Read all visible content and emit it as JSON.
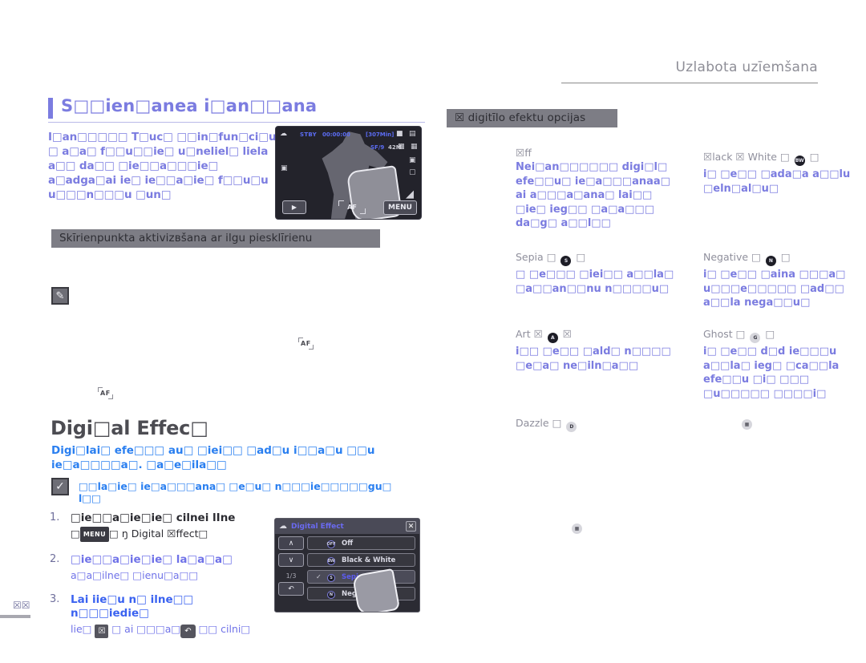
{
  "header": {
    "title": "Uzlabota uzīemšana"
  },
  "left": {
    "section_heading": "S□□ien□anea i□an□□ana",
    "intro": "I□an□□□□□ T□uc□ □□in□fun□ci□u □ a□a□ f□□u□□ie□ u□neliel□ liela a□□ da□□ □ie□□a□□□ie□ a□adga□ai ie□ ie□□a□ie□ f□□u□u u□□□n□□□u □un□",
    "banner_long_touch": "Skīrienpunkta aktivizвšana ar ilgu piesklīrienu",
    "af_marker_1": "AF",
    "af_marker_2": "AF",
    "note_icon": "note-pencil-icon"
  },
  "digital_effect": {
    "heading": "Digi□al Effec□",
    "description": "Digi□lai□ efe□□□ au□ □iei□□ □ad□u i□□a□u □□u ie□a□□□□a□. □a□e□ila□□",
    "check_note": "□□la□ie□ ie□a□□□ana□ □e□u□ n□□□ie□□□□□gu□ l□□",
    "steps": [
      {
        "num": "1.",
        "title": "□ie□□a□ie□ie□ cilnei lIne",
        "sub_prefix": "□",
        "sub_chip": "MENU",
        "sub_middle": "□ ŋ",
        "sub_suffix": "Digital ☒ffect□"
      },
      {
        "num": "2.",
        "title": "□ie□□a□ie□ie□ la□a□a□",
        "sub": "a□a□ilne□ □ienu□a□□"
      },
      {
        "num": "3.",
        "title": "Lai iie□u n□ ilne□□ n□□□iedie□",
        "sub_a": "lie□",
        "sub_x": "☒",
        "sub_b": "□ ai □□□a□",
        "sub_back": "↶",
        "sub_c": "□□ cilni□"
      }
    ]
  },
  "lcd_preview": {
    "status_stby": "STBY",
    "timecode": "00:00:00",
    "remaining": "[307Min]",
    "quality": "SF/9",
    "resolution": "42M",
    "play_button": "▶",
    "af_label": "AF",
    "menu_button": "MENU",
    "icons": [
      "camera-mode-icon",
      "battery-icon",
      "card-icon",
      "timer-icon",
      "face-detect-icon",
      "backlight-icon"
    ]
  },
  "dialog": {
    "title": "Digital Effect",
    "close_label": "✕",
    "up_label": "∧",
    "down_label": "∨",
    "page_indicator": "1/3",
    "back_label": "↶",
    "items": [
      {
        "label": "Off",
        "icon": "OFF",
        "selected": false
      },
      {
        "label": "Black & White",
        "icon": "BW",
        "selected": false
      },
      {
        "label": "Sepia",
        "icon": "S",
        "selected": true
      },
      {
        "label": "Negative",
        "icon": "N",
        "selected": false
      }
    ]
  },
  "right": {
    "banner": "☒ digitīlo efektu opcijas",
    "effects": [
      {
        "name": "☒ff",
        "icon": "",
        "desc": "Nei□an□□□□□□ digi□l□ efe□□u□ ie□a□□□anaa□ ai a□□□a□ana□ lai□□ □ie□ ieg□□ □a□a□□□ da□g□ a□□l□□"
      },
      {
        "name": "Sepia",
        "icon": "S",
        "desc": "□ □e□□□ □iei□□ a□□la□ □a□□an□□nu n□□□□u□"
      },
      {
        "name": "Art",
        "icon": "A",
        "desc": "i□□ □e□□ □ald□ n□□□□ □e□a□ ne□iln□a□□"
      },
      {
        "name": "Dazzle",
        "icon": "D",
        "desc": ""
      },
      {
        "name": "☒lack ☒ White",
        "icon": "BW",
        "desc": "i□ □e□□ □ada□a a□□lu □eln□al□u□"
      },
      {
        "name": "Negative",
        "icon": "N",
        "desc": "i□ □e□□ □aina □□□a□ u□□□e□□□□□ □ad□□ a□□la nega□□u□"
      },
      {
        "name": "Ghost",
        "icon": "G",
        "desc": "i□ □e□□ d□d ie□□□u a□□la□ ieg□ □ca□□la efe□□u □i□ □□□ □u□□□□□ □□□□i□"
      }
    ]
  },
  "footer": {
    "page_number": "☒☒"
  }
}
